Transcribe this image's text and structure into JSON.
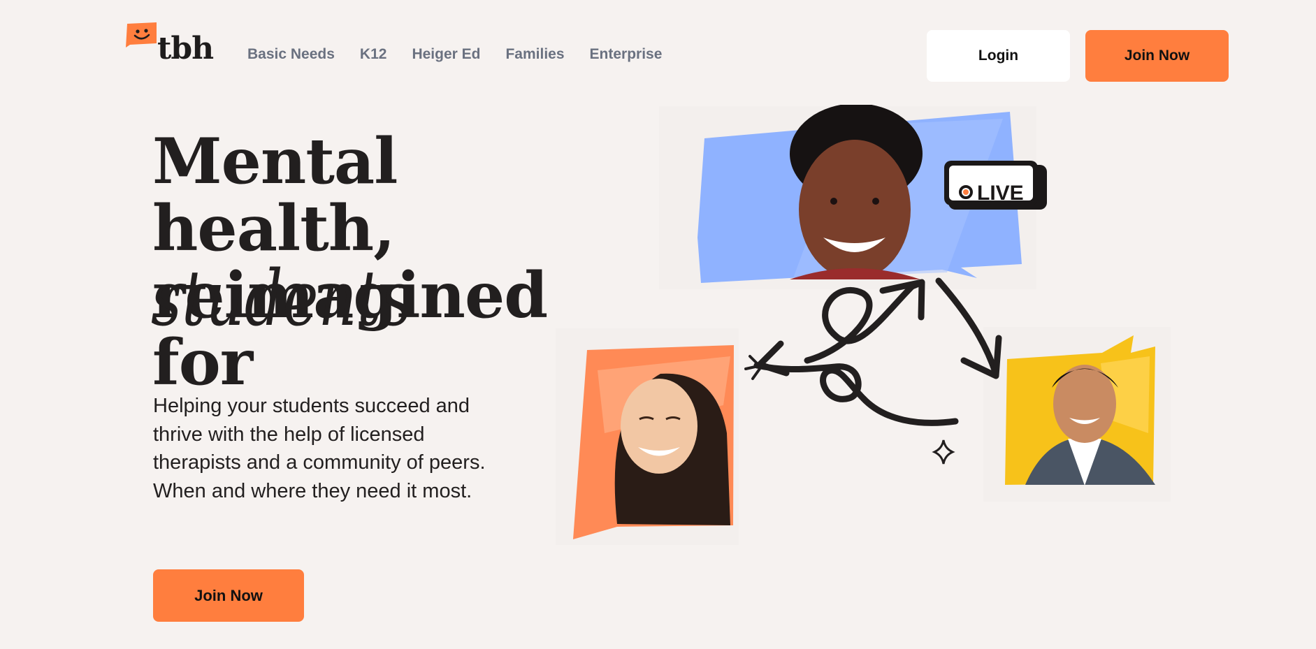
{
  "brand": {
    "name": "tbh",
    "accent": "#ff7e3e"
  },
  "nav": {
    "items": [
      "Basic Needs",
      "K12",
      "Heiger Ed",
      "Families",
      "Enterprise"
    ]
  },
  "header": {
    "login_label": "Login",
    "join_label": "Join Now"
  },
  "hero": {
    "headline_line1": "Mental health,",
    "headline_line2": "reimagined for",
    "headline_script": "students",
    "subtext": "Helping your students succeed and thrive with the help of licensed therapists and a community of peers. When and where they need it most.",
    "cta_label": "Join Now"
  },
  "illustration": {
    "live_badge": "LIVE",
    "colors": {
      "blue": "#8fb2ff",
      "orange": "#ff8a56",
      "yellow": "#f7c21a"
    }
  }
}
